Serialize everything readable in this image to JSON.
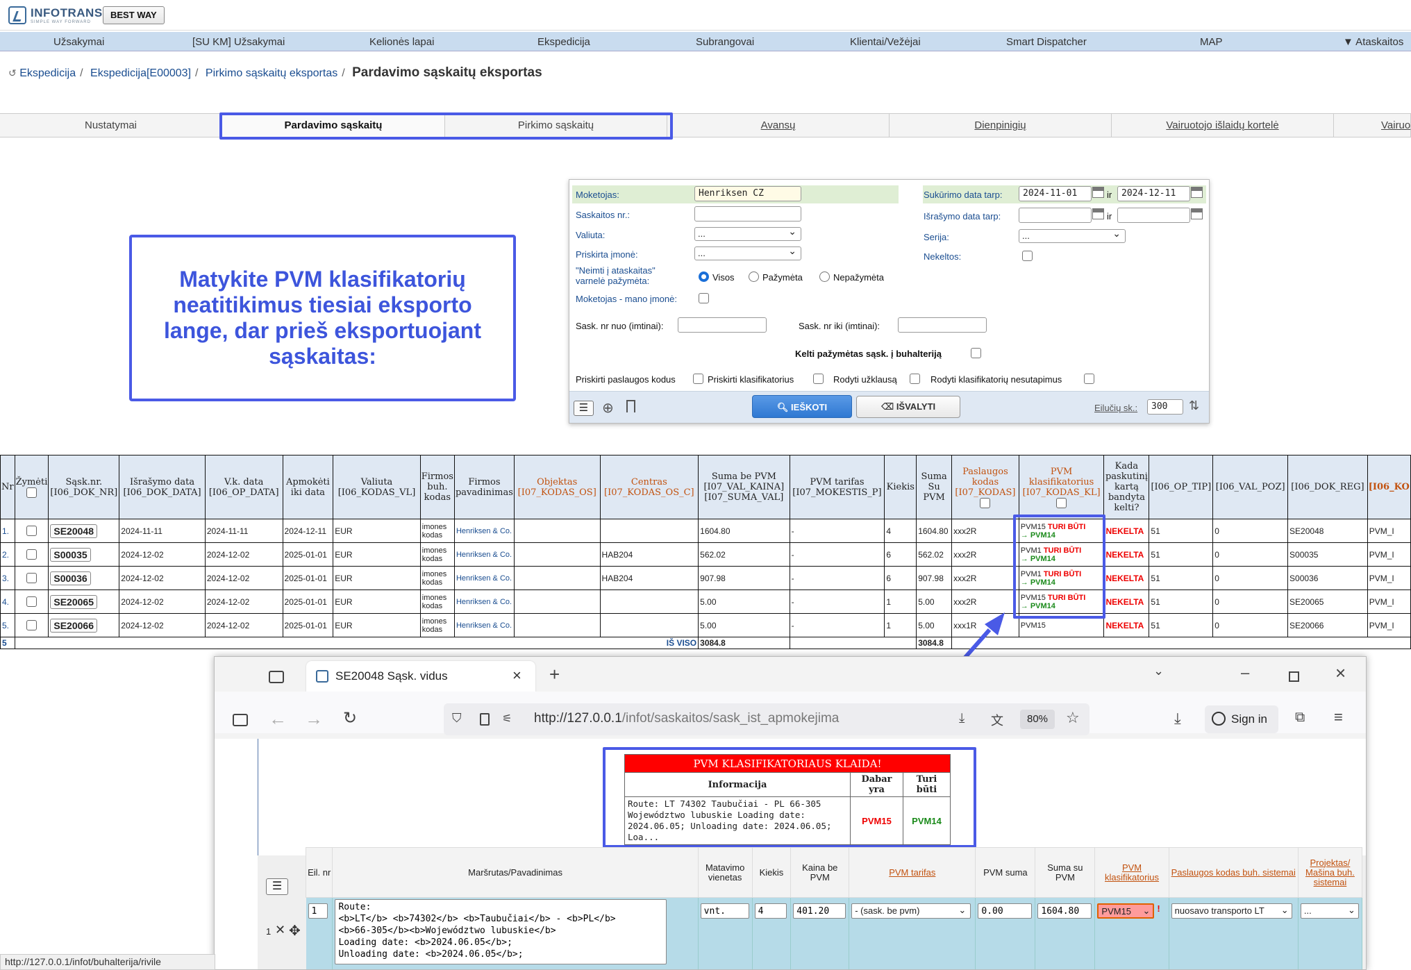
{
  "app": {
    "logo_name": "INFOTRANS",
    "logo_tagline": "SIMPLE WAY FORWARD",
    "company_button": "BEST WAY"
  },
  "nav": [
    "Užsakymai",
    "[SU KM] Užsakymai",
    "Kelionės lapai",
    "Ekspedicija",
    "Subrangovai",
    "Klientai/Vežėjai",
    "Smart Dispatcher",
    "MAP",
    "▼ Ataskaitos"
  ],
  "breadcrumb": {
    "items": [
      "Ekspedicija",
      "Ekspedicija[E00003]",
      "Pirkimo sąskaitų eksportas"
    ],
    "current": "Pardavimo sąskaitų eksportas"
  },
  "tabs": [
    "Nustatymai",
    "Pardavimo sąskaitų",
    "Pirkimo sąskaitų",
    "Avansų",
    "Dienpinigių",
    "Vairuotojo išlaidų kortelė",
    "Vairuo"
  ],
  "callout": "Matykite PVM klasifikatorių neatitikimus tiesiai eksporto lange, dar prieš eksportuojant sąskaitas:",
  "filter": {
    "moketojas_label": "Moketojas:",
    "moketojas_value": "Henriksen CZ",
    "saskaitos_label": "Saskaitos nr.:",
    "valiuta_label": "Valiuta:",
    "valiuta_value": "...",
    "priskirta_label": "Priskirta įmonė:",
    "priskirta_value": "...",
    "neimti_label": "\"Neimti į ataskaitas\" varnelė pažymėta:",
    "radio_all": "Visos",
    "radio_marked": "Pažymėta",
    "radio_unmarked": "Nepažymėta",
    "moketojas_mano_label": "Moketojas - mano įmonė:",
    "sukurimo_label": "Sukūrimo data tarp:",
    "sukurimo_from": "2024-11-01",
    "ir": "ir",
    "sukurimo_to": "2024-12-11",
    "israsymo_label": "Išrašymo data tarp:",
    "serija_label": "Serija:",
    "serija_value": "...",
    "nekeltos_label": "Nekeltos:",
    "nuo_label": "Sask. nr nuo (imtinai):",
    "iki_label": "Sask. nr iki (imtinai):",
    "kelti_label": "Kelti pažymėtas sąsk. į buhalteriją",
    "opt1": "Priskirti paslaugos kodus",
    "opt2": "Priskirti klasifikatorius",
    "opt3": "Rodyti užklausą",
    "opt4": "Rodyti klasifikatorių nesutapimus",
    "search_btn": "IEŠKOTI",
    "clear_btn": "IŠVALYTI",
    "rows_label": "Eilučių sk.:",
    "rows_value": "300"
  },
  "table": {
    "headers": [
      "Nr",
      "Žymėti",
      "Sąsk.nr. [I06_DOK_NR]",
      "Išrašymo data [I06_DOK_DATA]",
      "V.k. data [I06_OP_DATA]",
      "Apmokėti iki data",
      "Valiuta [I06_KODAS_VL]",
      "Firmos buh. kodas",
      "Firmos pavadinimas",
      "Objektas [I07_KODAS_OS]",
      "Centras [I07_KODAS_OS_C]",
      "Suma be PVM [I07_VAL_KAINA] [I07_SUMA_VAL]",
      "PVM tarifas [I07_MOKESTIS_P]",
      "Kiekis",
      "Suma Su PVM",
      "Paslaugos kodas [I07_KODAS]",
      "PVM klasifikatorius [I07_KODAS_KL]",
      "Kada paskutinį kartą bandyta kelti?",
      "[I06_OP_TIP]",
      "[I06_VAL_POZ]",
      "[I06_DOK_REG]",
      "[I06_KO"
    ],
    "rows": [
      {
        "nr": "1.",
        "sask": "SE20048",
        "isr": "2024-11-11",
        "vk": "2024-11-11",
        "apm": "2024-12-11",
        "val": "EUR",
        "buh": "imones kodas",
        "firm": "Henriksen & Co.",
        "obj": "",
        "cent": "",
        "suma": "1604.80",
        "pvm": "-",
        "kiek": "4",
        "susu": "1604.80",
        "kod": "xxx2R",
        "kl_now": "PVM15",
        "kl_must": "TURI BŪTI",
        "kl_to": "→ PVM14",
        "kada": "NEKELTA",
        "tip": "51",
        "poz": "0",
        "reg": "SE20048",
        "ko": "PVM_I"
      },
      {
        "nr": "2.",
        "sask": "S00035",
        "isr": "2024-12-02",
        "vk": "2024-12-02",
        "apm": "2025-01-01",
        "val": "EUR",
        "buh": "imones kodas",
        "firm": "Henriksen & Co.",
        "obj": "",
        "cent": "HAB204",
        "suma": "562.02",
        "pvm": "-",
        "kiek": "6",
        "susu": "562.02",
        "kod": "xxx2R",
        "kl_now": "PVM1",
        "kl_must": "TURI BŪTI",
        "kl_to": "→ PVM14",
        "kada": "NEKELTA",
        "tip": "51",
        "poz": "0",
        "reg": "S00035",
        "ko": "PVM_I"
      },
      {
        "nr": "3.",
        "sask": "S00036",
        "isr": "2024-12-02",
        "vk": "2024-12-02",
        "apm": "2025-01-01",
        "val": "EUR",
        "buh": "imones kodas",
        "firm": "Henriksen & Co.",
        "obj": "",
        "cent": "HAB204",
        "suma": "907.98",
        "pvm": "-",
        "kiek": "6",
        "susu": "907.98",
        "kod": "xxx2R",
        "kl_now": "PVM1",
        "kl_must": "TURI BŪTI",
        "kl_to": "→ PVM14",
        "kada": "NEKELTA",
        "tip": "51",
        "poz": "0",
        "reg": "S00036",
        "ko": "PVM_I"
      },
      {
        "nr": "4.",
        "sask": "SE20065",
        "isr": "2024-12-02",
        "vk": "2024-12-02",
        "apm": "2025-01-01",
        "val": "EUR",
        "buh": "imones kodas",
        "firm": "Henriksen & Co.",
        "obj": "",
        "cent": "",
        "suma": "5.00",
        "pvm": "-",
        "kiek": "1",
        "susu": "5.00",
        "kod": "xxx2R",
        "kl_now": "PVM15",
        "kl_must": "TURI BŪTI",
        "kl_to": "→ PVM14",
        "kada": "NEKELTA",
        "tip": "51",
        "poz": "0",
        "reg": "SE20065",
        "ko": "PVM_I"
      },
      {
        "nr": "5.",
        "sask": "SE20066",
        "isr": "2024-12-02",
        "vk": "2024-12-02",
        "apm": "2025-01-01",
        "val": "EUR",
        "buh": "imones kodas",
        "firm": "Henriksen & Co.",
        "obj": "",
        "cent": "",
        "suma": "5.00",
        "pvm": "-",
        "kiek": "1",
        "susu": "5.00",
        "kod": "xxx1R",
        "kl_now": "PVM15",
        "kl_must": "",
        "kl_to": "",
        "kada": "NEKELTA",
        "tip": "51",
        "poz": "0",
        "reg": "SE20066",
        "ko": "PVM_I"
      }
    ],
    "total_count": "5",
    "total_label": "IŠ VISO",
    "total_suma": "3084.8",
    "total_susu": "3084.8"
  },
  "browser": {
    "tab_title": "SE20048 Sąsk. vidus",
    "url_host": "http://127.0.0.1",
    "url_path": "/infot/saskaitos/sask_ist_apmokejimas.php?sask_id",
    "zoom": "80%",
    "signin": "Sign in",
    "error_title": "PVM KLASIFIKATORIAUS KLAIDA!",
    "error_headers": [
      "Informacija",
      "Dabar yra",
      "Turi būti"
    ],
    "error_info": "Route: LT 74302 Taubučiai - PL 66-305 Województwo lubuskie Loading date: 2024.06.05; Unloading date: 2024.06.05; Loa...",
    "error_now": "PVM15",
    "error_must": "PVM14",
    "item_headers": [
      "Eil. nr",
      "Maršrutas/Pavadinimas",
      "Matavimo vienetas",
      "Kiekis",
      "Kaina be PVM",
      "PVM tarifas",
      "PVM suma",
      "Suma su PVM",
      "PVM klasifikatorius",
      "Paslaugos kodas buh. sistemai",
      "Projektas/ Mašina buh. sistemai"
    ],
    "item": {
      "row": "1",
      "eil": "1",
      "route": "Route:\n<b>LT</b> <b>74302</b> <b>Taubučiai</b> - <b>PL</b>\n<b>66-305</b><b>Województwo lubuskie</b>\nLoading date: <b>2024.06.05</b>;\nUnloading date: <b>2024.06.05</b>;",
      "unit": "vnt.",
      "qty": "4",
      "price": "401.20",
      "vat_rate": "- (sask. be pvm)",
      "vat_sum": "0.00",
      "total": "1604.80",
      "klas": "PVM15",
      "service": "nuosavo transporto LT",
      "project": "..."
    },
    "statusbar": "http://127.0.0.1/infot/buhalterija/rivile"
  },
  "colors": {
    "highlight": "#4a5ae6",
    "error_red": "#e00000",
    "ok_green": "#1a8a1a",
    "nav_bg": "#c9dcef",
    "header_bg": "#dfe8f3"
  }
}
